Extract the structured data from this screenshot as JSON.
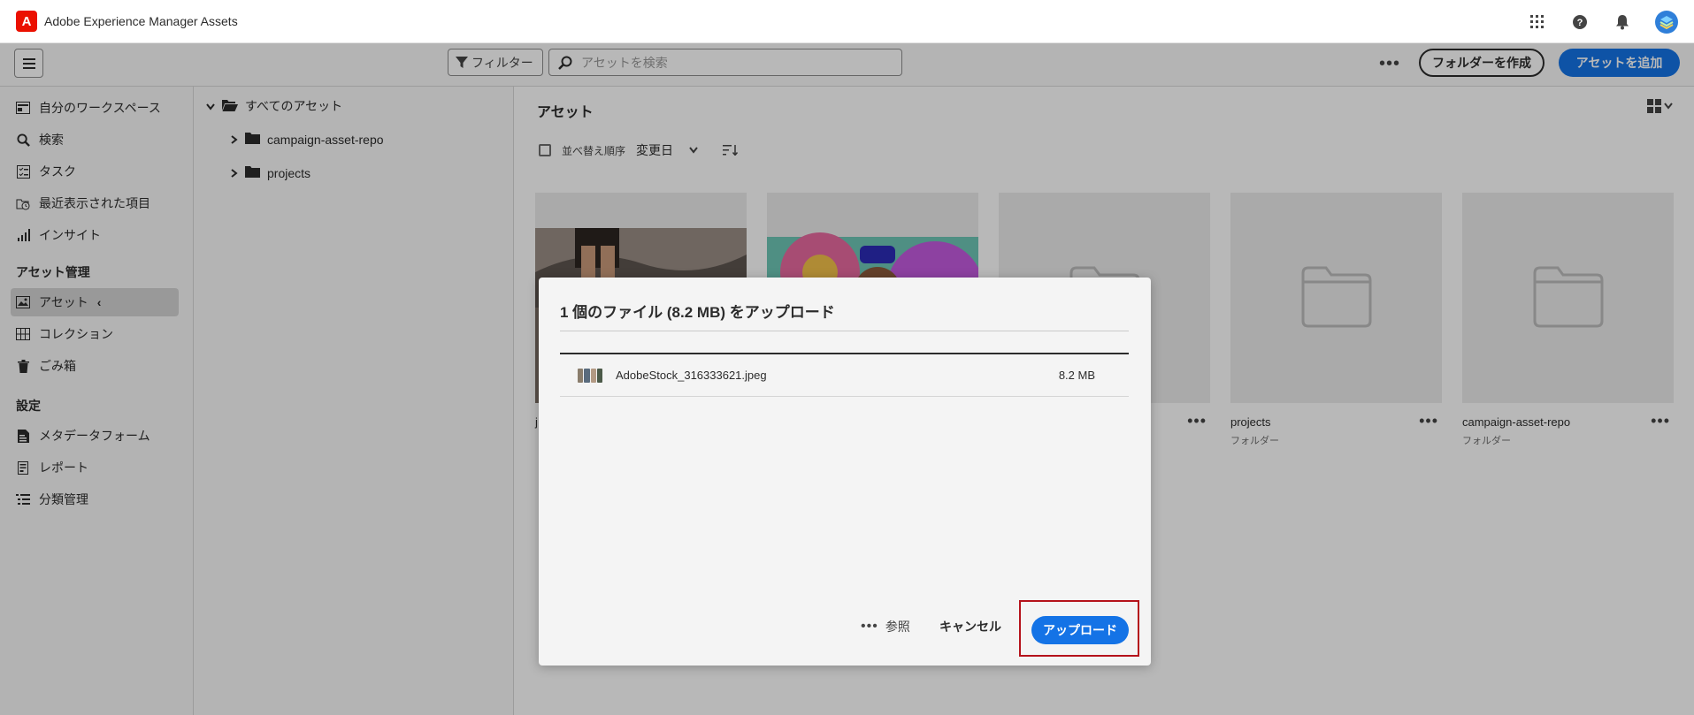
{
  "header": {
    "app_title": "Adobe Experience Manager Assets",
    "logo_letter": "A"
  },
  "toolbar": {
    "filter_label": "フィルター",
    "search_placeholder": "アセットを検索",
    "more_label": "•••",
    "create_folder_label": "フォルダーを作成",
    "add_asset_label": "アセットを追加"
  },
  "nav": {
    "items_top": [
      {
        "label": "自分のワークスペース",
        "icon": "workspace-icon"
      },
      {
        "label": "検索",
        "icon": "search-icon"
      },
      {
        "label": "タスク",
        "icon": "tasks-icon"
      },
      {
        "label": "最近表示された項目",
        "icon": "recent-icon"
      },
      {
        "label": "インサイト",
        "icon": "insights-icon"
      }
    ],
    "asset_mgmt_heading": "アセット管理",
    "items_assets": [
      {
        "label": "アセット",
        "icon": "assets-icon"
      },
      {
        "label": "コレクション",
        "icon": "collections-icon"
      },
      {
        "label": "ごみ箱",
        "icon": "trash-icon"
      }
    ],
    "settings_heading": "設定",
    "items_settings": [
      {
        "label": "メタデータフォーム",
        "icon": "metadata-icon"
      },
      {
        "label": "レポート",
        "icon": "reports-icon"
      },
      {
        "label": "分類管理",
        "icon": "taxonomy-icon"
      }
    ]
  },
  "tree": {
    "root_label": "すべてのアセット",
    "children": [
      {
        "label": "campaign-asset-repo"
      },
      {
        "label": "projects"
      }
    ]
  },
  "main": {
    "title": "アセット",
    "sort_label": "並べ替え順序",
    "sort_value": "変更日",
    "cards": [
      {
        "name": "j",
        "sub": "",
        "kind": "image"
      },
      {
        "name": "",
        "sub": "",
        "kind": "image"
      },
      {
        "name": "",
        "sub": "",
        "kind": "folder"
      },
      {
        "name": "projects",
        "sub": "フォルダー",
        "kind": "folder"
      },
      {
        "name": "campaign-asset-repo",
        "sub": "フォルダー",
        "kind": "folder"
      }
    ]
  },
  "dialog": {
    "title": "1 個のファイル (8.2 MB) をアップロード",
    "file_name": "AdobeStock_316333621.jpeg",
    "file_size": "8.2 MB",
    "browse_label": "参照",
    "cancel_label": "キャンセル",
    "upload_label": "アップロード"
  },
  "colors": {
    "accent": "#1473e6",
    "brand": "#eb1000",
    "highlight": "#b5121b"
  }
}
